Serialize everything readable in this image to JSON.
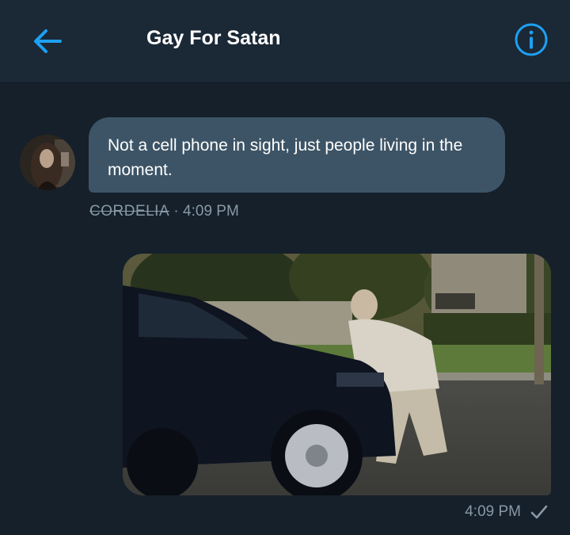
{
  "header": {
    "title": "Gay For Satan",
    "back_icon": "arrow-left-icon",
    "info_icon": "info-circle-icon",
    "accent": "#1da1f2"
  },
  "messages": [
    {
      "direction": "received",
      "text": "Not a cell phone in sight, just people living in the moment.",
      "sender": "CORDELIA",
      "separator": "·",
      "time": "4:09 PM"
    },
    {
      "direction": "sent",
      "media": "image",
      "time": "4:09 PM",
      "status_icon": "checkmark-icon"
    }
  ],
  "colors": {
    "background": "#15202b",
    "header": "#1b2836",
    "received_bubble": "#3d5466",
    "meta_text": "#8899a6"
  }
}
